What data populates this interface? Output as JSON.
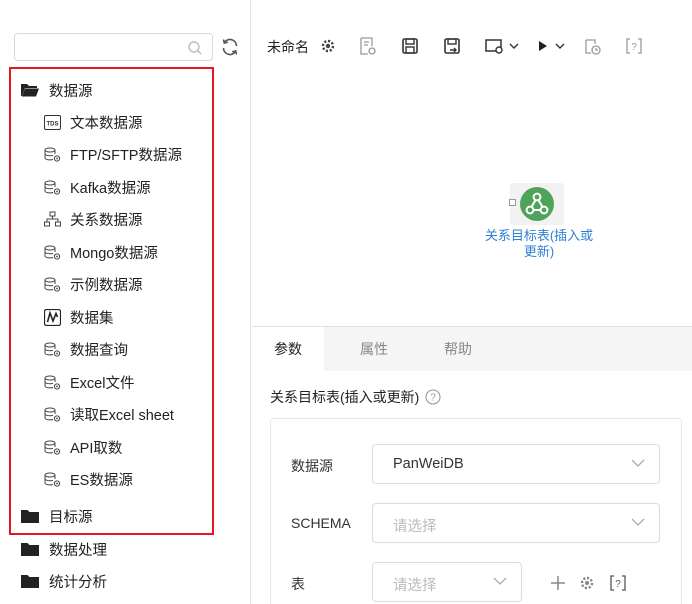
{
  "search": {
    "placeholder": ""
  },
  "tree": {
    "data_source": {
      "label": "数据源"
    },
    "items": [
      {
        "label": "文本数据源",
        "icon": "tds-icon"
      },
      {
        "label": "FTP/SFTP数据源",
        "icon": "database-gear-icon"
      },
      {
        "label": "Kafka数据源",
        "icon": "database-gear-icon"
      },
      {
        "label": "关系数据源",
        "icon": "relation-icon"
      },
      {
        "label": "Mongo数据源",
        "icon": "database-gear-icon"
      },
      {
        "label": "示例数据源",
        "icon": "database-gear-icon"
      },
      {
        "label": "数据集",
        "icon": "dataset-icon"
      },
      {
        "label": "数据查询",
        "icon": "database-gear-icon"
      },
      {
        "label": "Excel文件",
        "icon": "database-gear-icon"
      },
      {
        "label": "读取Excel sheet",
        "icon": "database-gear-icon"
      },
      {
        "label": "API取数",
        "icon": "database-gear-icon"
      },
      {
        "label": "ES数据源",
        "icon": "database-gear-icon"
      }
    ],
    "folders": [
      {
        "label": "目标源"
      },
      {
        "label": "数据处理"
      },
      {
        "label": "统计分析"
      }
    ]
  },
  "toolbar": {
    "title": "未命名"
  },
  "canvas": {
    "node_label": "关系目标表(插入或更新)"
  },
  "tabs": [
    {
      "label": "参数"
    },
    {
      "label": "属性"
    },
    {
      "label": "帮助"
    }
  ],
  "panel": {
    "title": "关系目标表(插入或更新)",
    "fields": [
      {
        "label": "数据源",
        "value": "PanWeiDB"
      },
      {
        "label": "SCHEMA",
        "placeholder": "请选择"
      },
      {
        "label": "表",
        "placeholder": "请选择"
      }
    ]
  },
  "colors": {
    "highlight": "#e8171e",
    "link": "#2d7fd6",
    "node_green": "#4fa35a"
  }
}
